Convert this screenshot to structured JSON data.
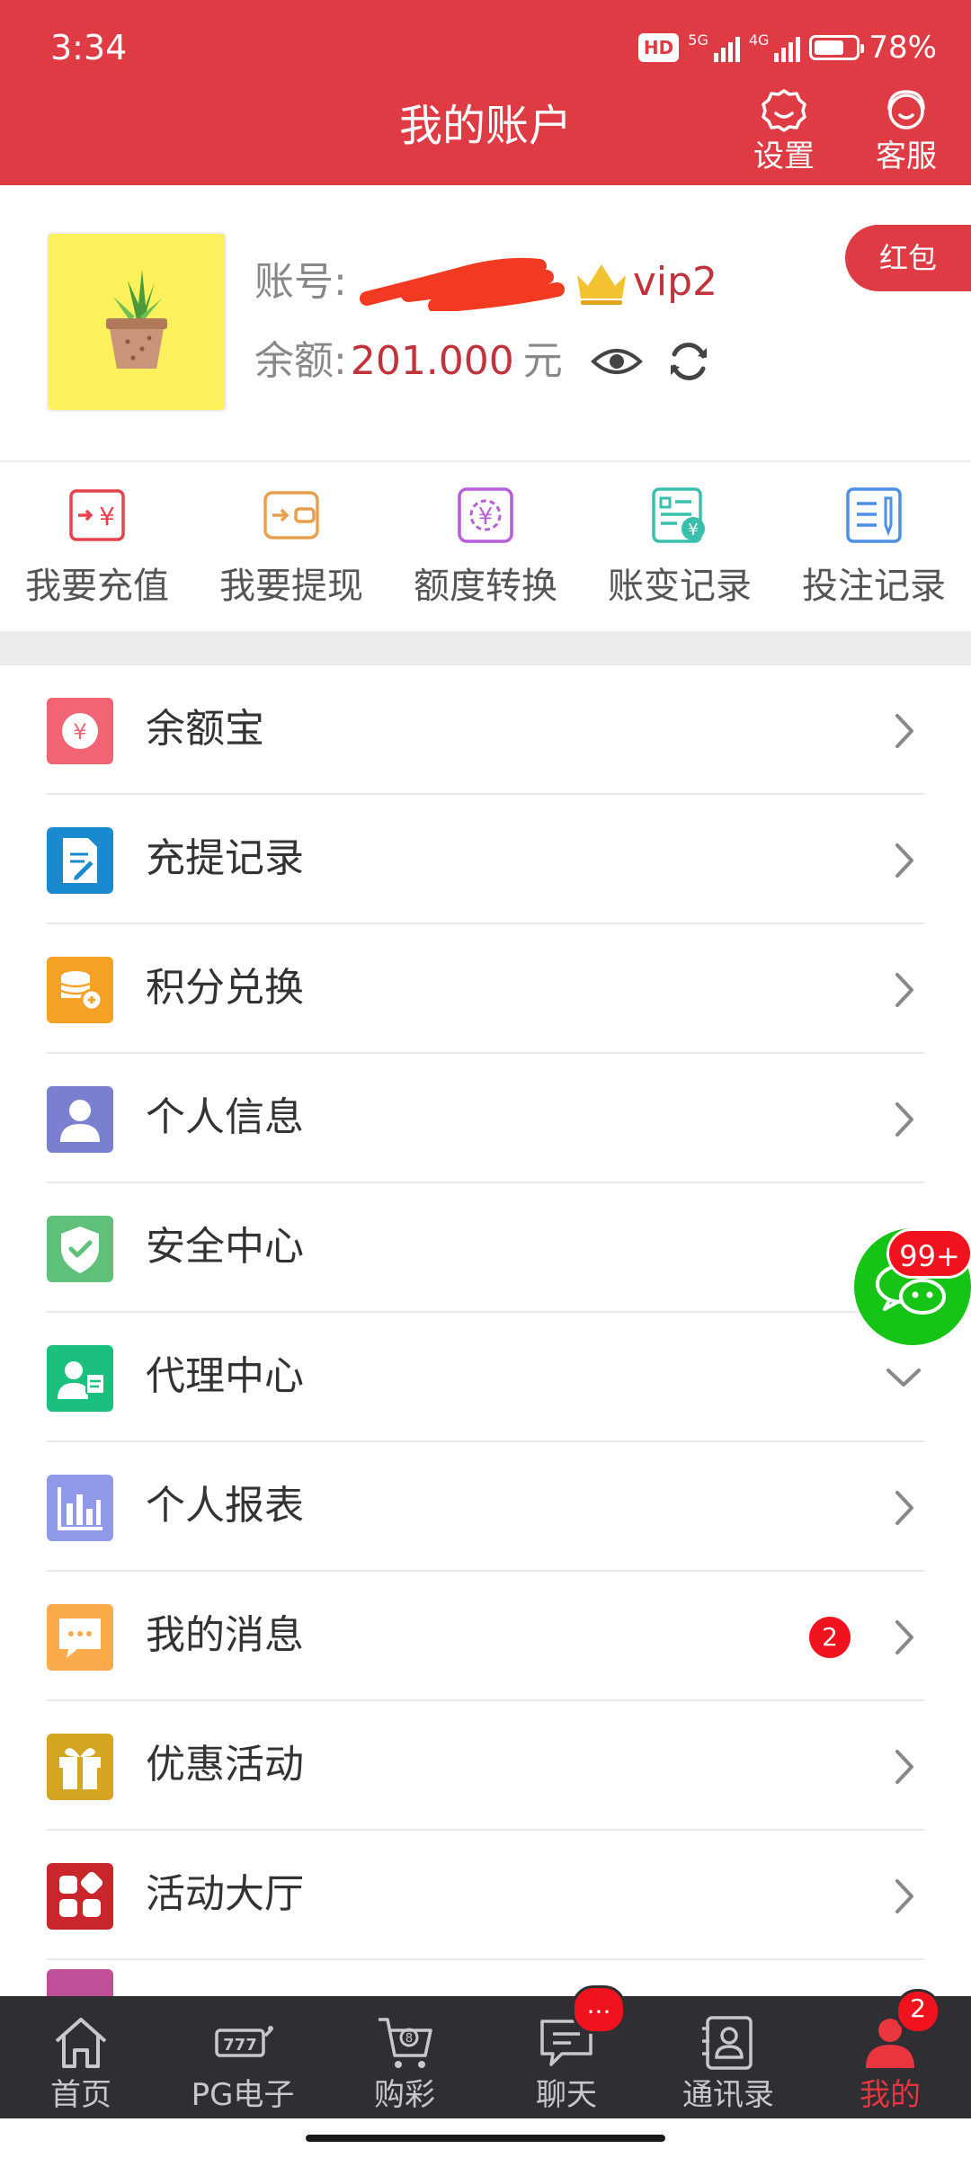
{
  "status_bar": {
    "time": "3:34",
    "hd": "HD",
    "net1": "5G",
    "net2": "4G",
    "battery": "78%"
  },
  "header": {
    "title": "我的账户",
    "settings_label": "设置",
    "service_label": "客服"
  },
  "profile": {
    "account_label": "账号:",
    "vip_level": "vip2",
    "balance_label": "余额:",
    "balance_value": "201.000",
    "balance_unit": "元",
    "red_packet_label": "红包"
  },
  "quick_actions": [
    {
      "label": "我要充值",
      "icon": "recharge-icon",
      "color": "#e5424d"
    },
    {
      "label": "我要提现",
      "icon": "withdraw-icon",
      "color": "#e8a04e"
    },
    {
      "label": "额度转换",
      "icon": "transfer-icon",
      "color": "#b65fd9"
    },
    {
      "label": "账变记录",
      "icon": "account-record-icon",
      "color": "#3bbfad"
    },
    {
      "label": "投注记录",
      "icon": "bet-record-icon",
      "color": "#4f8fe6"
    }
  ],
  "menu": [
    {
      "label": "余额宝",
      "icon": "yuebao-icon",
      "color": "#f06474",
      "trailing": "chevron"
    },
    {
      "label": "充提记录",
      "icon": "document-edit-icon",
      "color": "#1a8ad0",
      "trailing": "chevron"
    },
    {
      "label": "积分兑换",
      "icon": "coins-icon",
      "color": "#f5a124",
      "trailing": "chevron"
    },
    {
      "label": "个人信息",
      "icon": "user-icon",
      "color": "#7b7fcf",
      "trailing": "chevron"
    },
    {
      "label": "安全中心",
      "icon": "shield-check-icon",
      "color": "#5fc179",
      "trailing": "chevron"
    },
    {
      "label": "代理中心",
      "icon": "agent-icon",
      "color": "#1bc07f",
      "trailing": "chevron-down"
    },
    {
      "label": "个人报表",
      "icon": "bar-chart-icon",
      "color": "#8f99e8",
      "trailing": "chevron"
    },
    {
      "label": "我的消息",
      "icon": "message-icon",
      "color": "#fbaa4c",
      "trailing": "chevron",
      "badge": "2"
    },
    {
      "label": "优惠活动",
      "icon": "gift-icon",
      "color": "#d4a520",
      "trailing": "chevron"
    },
    {
      "label": "活动大厅",
      "icon": "grid-icon",
      "color": "#c8262c",
      "trailing": "chevron"
    }
  ],
  "floating_chat": {
    "badge": "99+",
    "color": "#16c416"
  },
  "bottom_nav": [
    {
      "label": "首页",
      "icon": "home-icon"
    },
    {
      "label": "PG电子",
      "icon": "slot-machine-icon"
    },
    {
      "label": "购彩",
      "icon": "lottery-cart-icon"
    },
    {
      "label": "聊天",
      "icon": "chat-icon",
      "badge": "..."
    },
    {
      "label": "通讯录",
      "icon": "contacts-icon"
    },
    {
      "label": "我的",
      "icon": "profile-icon",
      "badge": "2",
      "active": true
    }
  ],
  "colors": {
    "brand_red": "#de3b45",
    "nav_bg": "#2e2e33",
    "active_nav": "#e8353e",
    "value_red": "#c0333b"
  }
}
